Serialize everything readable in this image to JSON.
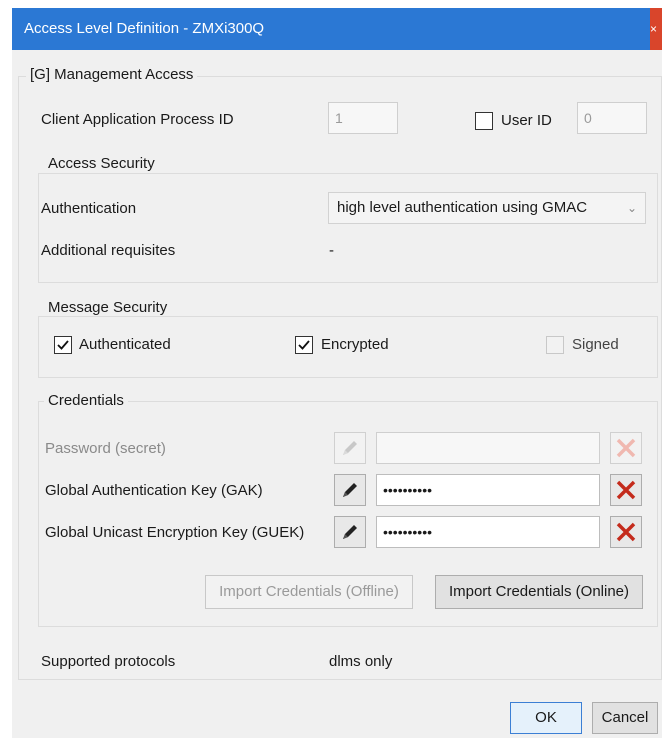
{
  "window": {
    "title": "Access Level Definition - ZMXi300Q",
    "close_glyph": "×"
  },
  "management": {
    "legend": "[G] Management Access",
    "client_app_label": "Client Application Process ID",
    "client_app_value": "1",
    "user_id_label": "User ID",
    "user_id_checked": false,
    "user_id_value": "0"
  },
  "access_security": {
    "legend": "Access Security",
    "authentication_label": "Authentication",
    "authentication_value": "high level authentication using GMAC",
    "additional_label": "Additional requisites",
    "additional_value": "-"
  },
  "message_security": {
    "legend": "Message Security",
    "authenticated_label": "Authenticated",
    "authenticated_checked": true,
    "encrypted_label": "Encrypted",
    "encrypted_checked": true,
    "signed_label": "Signed",
    "signed_checked": false
  },
  "credentials": {
    "legend": "Credentials",
    "password_label": "Password (secret)",
    "password_value": "",
    "gak_label": "Global Authentication Key (GAK)",
    "gak_value": "••••••••••",
    "guek_label": "Global Unicast Encryption Key (GUEK)",
    "guek_value": "••••••••••",
    "import_offline_label": "Import Credentials (Offline)",
    "import_online_label": "Import Credentials (Online)",
    "icons": {
      "edit": "pencil-icon",
      "clear": "x-icon"
    },
    "colors": {
      "clear_active": "#c42b1c",
      "clear_disabled": "#f0b8b0"
    }
  },
  "footer": {
    "protocols_label": "Supported protocols",
    "protocols_value": "dlms only",
    "ok_label": "OK",
    "cancel_label": "Cancel"
  }
}
